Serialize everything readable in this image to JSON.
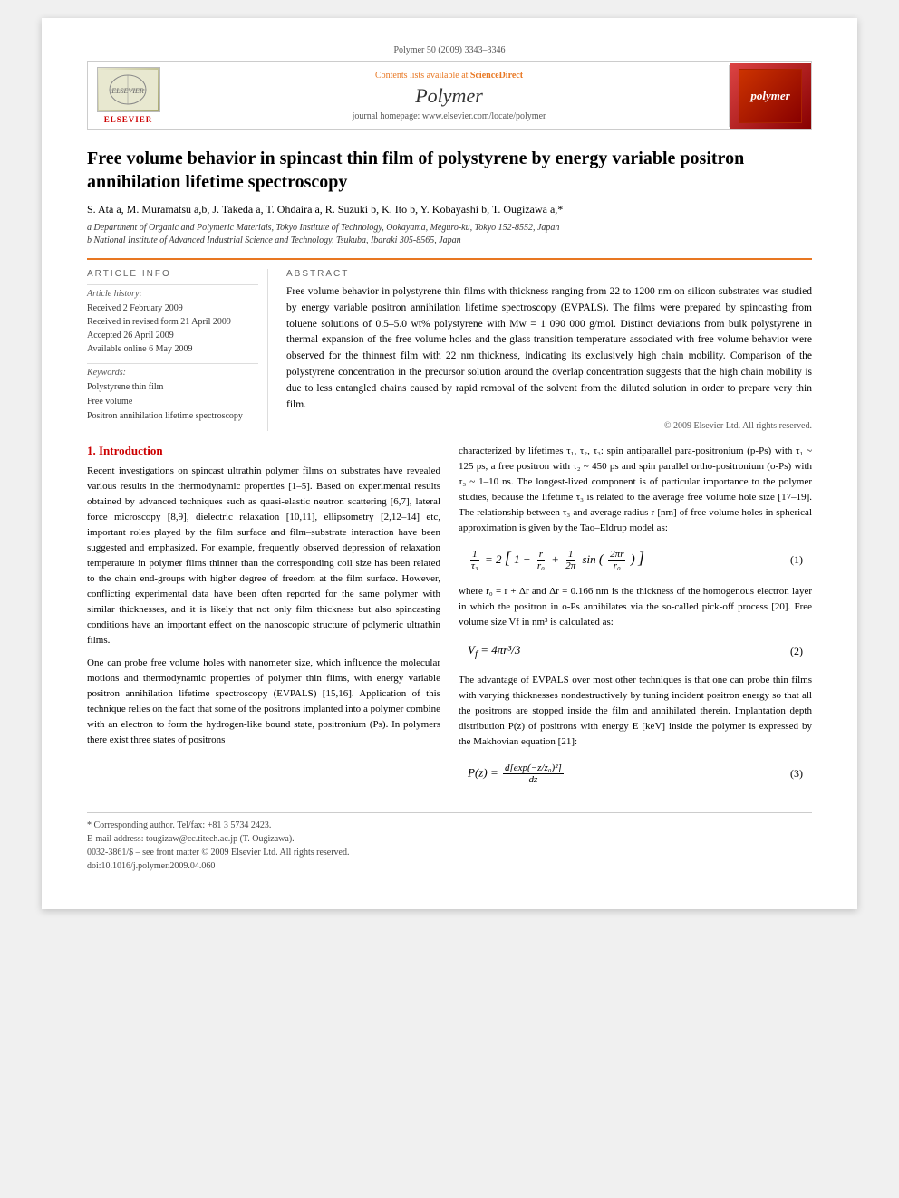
{
  "header": {
    "top_bar": "Polymer 50 (2009) 3343–3346",
    "sciencedirect_prefix": "Contents lists available at ",
    "sciencedirect_label": "ScienceDirect",
    "journal_name": "Polymer",
    "homepage_label": "journal homepage: www.elsevier.com/locate/polymer",
    "elsevier_label": "ELSEVIER",
    "polymer_badge": "polymer"
  },
  "article": {
    "title": "Free volume behavior in spincast thin film of polystyrene by energy variable positron annihilation lifetime spectroscopy",
    "authors": "S. Ata a, M. Muramatsu a,b, J. Takeda a, T. Ohdaira a, R. Suzuki b, K. Ito b, Y. Kobayashi b, T. Ougizawa a,*",
    "affiliation_a": "a Department of Organic and Polymeric Materials, Tokyo Institute of Technology, Ookayama, Meguro-ku, Tokyo 152-8552, Japan",
    "affiliation_b": "b National Institute of Advanced Industrial Science and Technology, Tsukuba, Ibaraki 305-8565, Japan"
  },
  "article_info": {
    "heading": "ARTICLE INFO",
    "history_label": "Article history:",
    "received": "Received 2 February 2009",
    "received_revised": "Received in revised form 21 April 2009",
    "accepted": "Accepted 26 April 2009",
    "available": "Available online 6 May 2009",
    "keywords_label": "Keywords:",
    "keyword1": "Polystyrene thin film",
    "keyword2": "Free volume",
    "keyword3": "Positron annihilation lifetime spectroscopy"
  },
  "abstract": {
    "heading": "ABSTRACT",
    "text": "Free volume behavior in polystyrene thin films with thickness ranging from 22 to 1200 nm on silicon substrates was studied by energy variable positron annihilation lifetime spectroscopy (EVPALS). The films were prepared by spincasting from toluene solutions of 0.5–5.0 wt% polystyrene with Mw = 1 090 000 g/mol. Distinct deviations from bulk polystyrene in thermal expansion of the free volume holes and the glass transition temperature associated with free volume behavior were observed for the thinnest film with 22 nm thickness, indicating its exclusively high chain mobility. Comparison of the polystyrene concentration in the precursor solution around the overlap concentration suggests that the high chain mobility is due to less entangled chains caused by rapid removal of the solvent from the diluted solution in order to prepare very thin film.",
    "copyright": "© 2009 Elsevier Ltd. All rights reserved."
  },
  "section1": {
    "title": "1. Introduction",
    "para1": "Recent investigations on spincast ultrathin polymer films on substrates have revealed various results in the thermodynamic properties [1–5]. Based on experimental results obtained by advanced techniques such as quasi-elastic neutron scattering [6,7], lateral force microscopy [8,9], dielectric relaxation [10,11], ellipsometry [2,12–14] etc, important roles played by the film surface and film–substrate interaction have been suggested and emphasized. For example, frequently observed depression of relaxation temperature in polymer films thinner than the corresponding coil size has been related to the chain end-groups with higher degree of freedom at the film surface. However, conflicting experimental data have been often reported for the same polymer with similar thicknesses, and it is likely that not only film thickness but also spincasting conditions have an important effect on the nanoscopic structure of polymeric ultrathin films.",
    "para2": "One can probe free volume holes with nanometer size, which influence the molecular motions and thermodynamic properties of polymer thin films, with energy variable positron annihilation lifetime spectroscopy (EVPALS) [15,16]. Application of this technique relies on the fact that some of the positrons implanted into a polymer combine with an electron to form the hydrogen-like bound state, positronium (Ps). In polymers there exist three states of positrons"
  },
  "section1_right": {
    "para1": "characterized by lifetimes τ₁, τ₂, τ₃: spin antiparallel para-positronium (p-Ps) with τ₁ ~ 125 ps, a free positron with τ₂ ~ 450 ps and spin parallel ortho-positronium (o-Ps) with τ₃ ~ 1–10 ns. The longest-lived component is of particular importance to the polymer studies, because the lifetime τ₃ is related to the average free volume hole size [17–19]. The relationship between τ₃ and average radius r [nm] of free volume holes in spherical approximation is given by the Tao–Eldrup model as:",
    "eq1_label": "(1)",
    "eq1_lhs": "1/τ₃",
    "eq1_rhs": "2[1 − r/r₀ + (1/2π)sin(2πr/r₀)]",
    "eq1_text": "where r₀ = r + Δr and Δr = 0.166 nm is the thickness of the homogenous electron layer in which the positron in o-Ps annihilates via the so-called pick-off process [20]. Free volume size Vf in nm³ is calculated as:",
    "eq2_label": "(2)",
    "eq2_text": "Vf = 4πr³/3",
    "para2": "The advantage of EVPALS over most other techniques is that one can probe thin films with varying thicknesses nondestructively by tuning incident positron energy so that all the positrons are stopped inside the film and annihilated therein. Implantation depth distribution P(z) of positrons with energy E [keV] inside the polymer is expressed by the Makhovian equation [21]:",
    "eq3_label": "(3)",
    "eq3_text": "P(z) = d[exp(−z/z₀)²]/dz"
  },
  "footnotes": {
    "corresponding": "* Corresponding author. Tel/fax: +81 3 5734 2423.",
    "email": "E-mail address: tougizaw@cc.titech.ac.jp (T. Ougizawa).",
    "issn": "0032-3861/$ – see front matter © 2009 Elsevier Ltd. All rights reserved.",
    "doi": "doi:10.1016/j.polymer.2009.04.060"
  }
}
